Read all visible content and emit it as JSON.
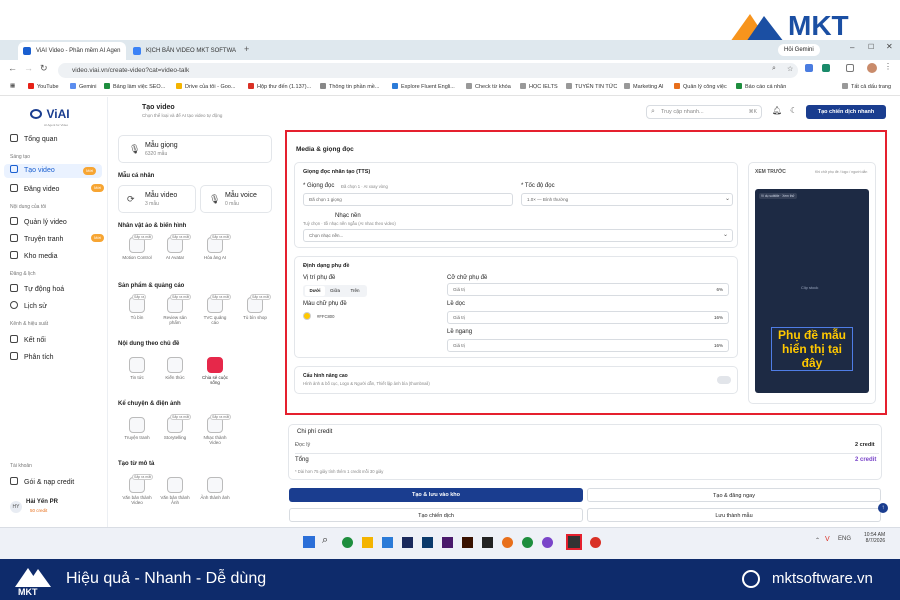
{
  "brand": {
    "name": "MKT",
    "tagline": "Hiệu quả - Nhanh - Dễ dùng",
    "website": "mktsoftware.vn"
  },
  "browser": {
    "tabs": [
      "ViAI Video - Phần mềm AI Agen",
      "KỊCH BẢN VIDEO MKT SOFTWA"
    ],
    "gemini": "Hỏi Gemini",
    "url": "video.viai.vn/create-video?cat=video-talk",
    "bookmarks": [
      "YouTube",
      "Gemini",
      "Bảng làm việc SEO...",
      "Drive của tôi - Goo...",
      "Hộp thư đến (1.137)...",
      "Thông tin phần mề...",
      "Explore Fluent Engli...",
      "Check từ khóa",
      "HỌC IELTS",
      "TUYỂN TIN TỨC",
      "Marketing AI",
      "Quản lý công việc",
      "Báo cáo cá nhân"
    ],
    "all_bookmarks": "Tất cả dấu trang"
  },
  "sidebar": {
    "logo": "ViAI",
    "logo_sub": "AI Agent for Video",
    "items": [
      {
        "label": "Tổng quan"
      },
      {
        "header": "Sáng tạo"
      },
      {
        "label": "Tạo video",
        "badge": "Mới",
        "active": true
      },
      {
        "label": "Đăng video",
        "badge": "Mới"
      },
      {
        "header": "Nội dung của tôi"
      },
      {
        "label": "Quản lý video"
      },
      {
        "label": "Truyện tranh",
        "badge": "Mới"
      },
      {
        "label": "Kho media"
      },
      {
        "header": "Đăng & lịch"
      },
      {
        "label": "Tự động hoá"
      },
      {
        "label": "Lịch sử"
      },
      {
        "header": "Kênh & hiệu suất"
      },
      {
        "label": "Kết nối"
      },
      {
        "label": "Phân tích"
      }
    ],
    "account_header": "Tài khoản",
    "credit_pack": "Gói & nạp credit",
    "user_name": "Hải Yến PR",
    "user_credit": "50 credit",
    "user_initials": "HY"
  },
  "topbar": {
    "title": "Tạo video",
    "subtitle": "Chọn thể loại và để AI tạo video tự động",
    "search_placeholder": "Truy cập nhanh...",
    "shortcut": "⌘K",
    "campaign_btn": "Tạo chiến dịch nhanh"
  },
  "left_panel": {
    "voice_sample": {
      "title": "Mẫu giọng",
      "count": "6320 mẫu"
    },
    "personal_header": "Mẫu cá nhân",
    "personal": [
      {
        "title": "Mẫu video",
        "count": "3 mẫu"
      },
      {
        "title": "Mẫu voice",
        "count": "0 mẫu"
      }
    ],
    "groups": [
      {
        "title": "Nhân vật ảo & biến hình",
        "items": [
          {
            "label": "Motion Control",
            "soon": "Sắp ra mắt"
          },
          {
            "label": "AI Avatar",
            "soon": "Sắp ra mắt"
          },
          {
            "label": "Hóa ảng AI",
            "soon": "Sắp ra mắt"
          }
        ]
      },
      {
        "title": "Sản phẩm & quảng cáo",
        "items": [
          {
            "label": "Tù bìn",
            "soon": "Sắp ra"
          },
          {
            "label": "Review sản phẩm",
            "soon": "Sắp ra mắt"
          },
          {
            "label": "TVC quảng cáo",
            "soon": "Sắp ra mắt"
          },
          {
            "label": "Tù bìn shop",
            "soon": "Sắp ra mắt"
          }
        ]
      },
      {
        "title": "Nội dung theo chủ đề",
        "items": [
          {
            "label": "Tin tức"
          },
          {
            "label": "Kiến thức"
          },
          {
            "label": "Chia sẻ cuộc sống",
            "active": true
          }
        ]
      },
      {
        "title": "Kể chuyện & điện ảnh",
        "items": [
          {
            "label": "Truyện tranh"
          },
          {
            "label": "Storytelling",
            "soon": "Sắp ra mắt"
          },
          {
            "label": "Nhạc thành Video",
            "soon": "Sắp ra mắt"
          }
        ]
      },
      {
        "title": "Tạo từ mô tả",
        "items": [
          {
            "label": "Văn bản thành Video",
            "soon": "Sắp ra mắt"
          },
          {
            "label": "Văn bản thành Ảnh"
          },
          {
            "label": "Ảnh thành ảnh"
          }
        ]
      }
    ]
  },
  "form": {
    "section_title": "Media & giọng đọc",
    "tts_title": "Giọng đọc nhân tạo (TTS)",
    "voice_label": "* Giọng đọc",
    "voice_hint": "Đã chọn 1 · AI xoay vòng",
    "voice_value": "Đã chọn 1 giọng",
    "speed_label": "* Tốc độ đọc",
    "speed_value": "1.0× — Bình thường",
    "music_label": "Nhạc nền",
    "music_hint": "Tuỳ chọn · tối nhạc nền ngẫu (AI nhac theo video)",
    "music_placeholder": "Chọn nhạc nền...",
    "subtitle_title": "Định dạng phụ đề",
    "position_label": "Vị trí phụ đề",
    "positions": [
      "Dưới",
      "Giữa",
      "Trên"
    ],
    "color_label": "Màu chữ phụ đề",
    "color_value": "#FFC800",
    "font_size_label": "Cỡ chữ phụ đề",
    "font_size": "6%",
    "v_margin_label": "Lề dọc",
    "v_margin": "16%",
    "h_margin_label": "Lề ngang",
    "h_margin": "16%",
    "value_placeholder": "Giá trị",
    "advanced_title": "Cấu hình nâng cao",
    "advanced_hint": "Hình ảnh & bố cục, Logo & Người dẫn, Thiết lập ảnh bìa (thumbnail)"
  },
  "preview": {
    "title": "XEM TRƯỚC",
    "hint": "Khi chữ phụ đề / logo / người dẫn",
    "tag": "Ví dụ subtitle · Xem thử",
    "clip": "Clip stock",
    "subtitle": [
      "Phụ đề mẫu",
      "hiển thị tại",
      "đây"
    ]
  },
  "cost": {
    "title": "Chi phí credit",
    "line1_label": "Đọc lý",
    "line1_value": "2 credit",
    "total_label": "Tổng",
    "total_value": "2 credit",
    "note": "* Dài hơn 75 giây tính thêm 1 credit mỗi 30 giây"
  },
  "actions": {
    "save": "Tạo & lưu vào kho",
    "post": "Tạo & đăng ngay",
    "campaign": "Tạo chiến dịch",
    "template": "Lưu thành mẫu"
  },
  "taskbar": {
    "time": "10:54 AM",
    "date": "8/7/2026",
    "lang": "ENG"
  },
  "colors": {
    "accent": "#1a3d8f",
    "highlight_red": "#e5202e",
    "subtitle_color": "#FFC800",
    "footer_bg": "#0e2b6b"
  }
}
